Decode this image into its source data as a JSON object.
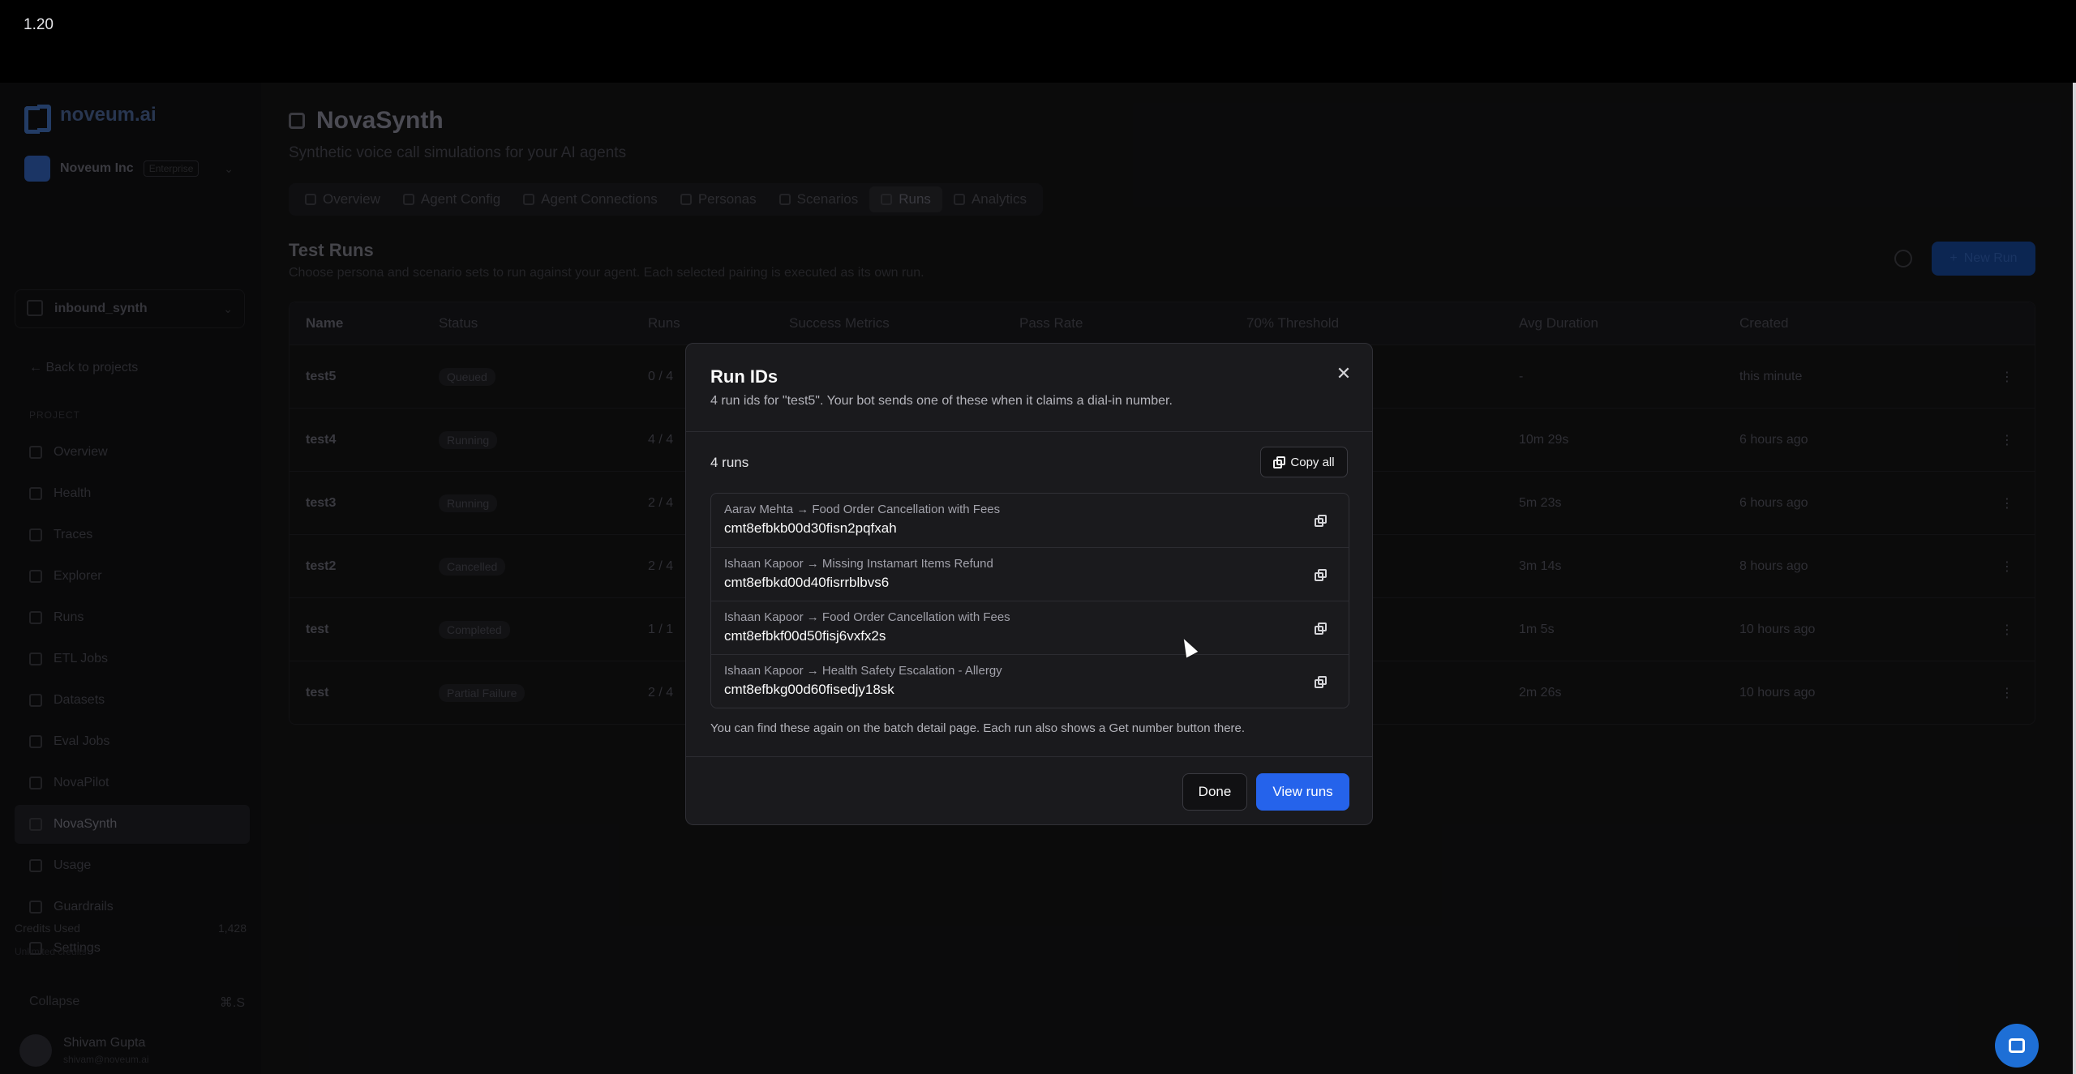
{
  "topbar": {
    "version": "1.20"
  },
  "sidebar": {
    "logo": "noveum.ai",
    "org": {
      "name": "Noveum Inc",
      "plan": "Enterprise"
    },
    "project": "inbound_synth",
    "back": "Back to projects",
    "section": "PROJECT",
    "items": [
      {
        "label": "Overview"
      },
      {
        "label": "Health"
      },
      {
        "label": "Traces"
      },
      {
        "label": "Explorer"
      },
      {
        "label": "Runs"
      },
      {
        "label": "ETL Jobs"
      },
      {
        "label": "Datasets"
      },
      {
        "label": "Eval Jobs"
      },
      {
        "label": "NovaPilot"
      },
      {
        "label": "NovaSynth"
      },
      {
        "label": "Usage"
      },
      {
        "label": "Guardrails"
      },
      {
        "label": "Settings"
      }
    ],
    "credits": {
      "label": "Credits Used",
      "value": "1,428",
      "sub": "Unlimited credits"
    },
    "collapse": {
      "label": "Collapse",
      "shortcut": "⌘.S"
    },
    "user": {
      "name": "Shivam Gupta",
      "email": "shivam@noveum.ai"
    }
  },
  "page": {
    "title": "NovaSynth",
    "subtitle": "Synthetic voice call simulations for your AI agents",
    "tabs": [
      "Overview",
      "Agent Config",
      "Agent Connections",
      "Personas",
      "Scenarios",
      "Runs",
      "Analytics"
    ],
    "section_title": "Test Runs",
    "section_sub": "Choose persona and scenario sets to run against your agent. Each selected pairing is executed as its own run.",
    "new_run": "New Run"
  },
  "table": {
    "headers": [
      "Name",
      "Status",
      "Runs",
      "Success Metrics",
      "Pass Rate",
      "70% Threshold",
      "Avg Duration",
      "Created"
    ],
    "rows": [
      {
        "name": "test5",
        "status": "Queued",
        "runs": "0 / 4",
        "duration": "-",
        "created": "this minute"
      },
      {
        "name": "test4",
        "status": "Running",
        "runs": "4 / 4",
        "duration": "10m 29s",
        "created": "6 hours ago"
      },
      {
        "name": "test3",
        "status": "Running",
        "runs": "2 / 4",
        "duration": "5m 23s",
        "created": "6 hours ago"
      },
      {
        "name": "test2",
        "status": "Cancelled",
        "runs": "2 / 4",
        "duration": "3m 14s",
        "created": "8 hours ago"
      },
      {
        "name": "test",
        "status": "Completed",
        "runs": "1 / 1",
        "duration": "1m 5s",
        "created": "10 hours ago"
      },
      {
        "name": "test",
        "status": "Partial Failure",
        "runs": "2 / 4",
        "duration": "2m 26s",
        "created": "10 hours ago"
      }
    ]
  },
  "modal": {
    "title": "Run IDs",
    "description": "4 run ids for \"test5\". Your bot sends one of these when it claims a dial-in number.",
    "count": "4 runs",
    "copy_all": "Copy all",
    "runs": [
      {
        "label": "Aarav Mehta → Food Order Cancellation with Fees",
        "id": "cmt8efbkb00d30fisn2pqfxah"
      },
      {
        "label": "Ishaan Kapoor → Missing Instamart Items Refund",
        "id": "cmt8efbkd00d40fisrrblbvs6"
      },
      {
        "label": "Ishaan Kapoor → Food Order Cancellation with Fees",
        "id": "cmt8efbkf00d50fisj6vxfx2s"
      },
      {
        "label": "Ishaan Kapoor → Health Safety Escalation - Allergy",
        "id": "cmt8efbkg00d60fisedjy18sk"
      }
    ],
    "hint": "You can find these again on the batch detail page. Each run also shows a Get number button there.",
    "done": "Done",
    "view_runs": "View runs"
  }
}
